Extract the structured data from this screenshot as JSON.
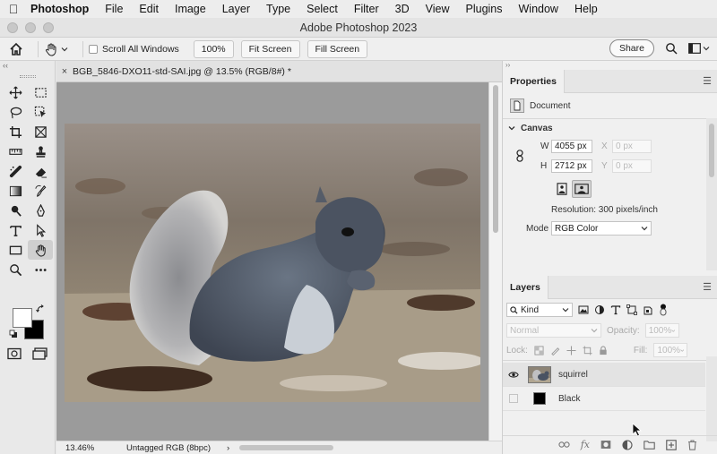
{
  "menubar": {
    "app": "Photoshop",
    "items": [
      "File",
      "Edit",
      "Image",
      "Layer",
      "Type",
      "Select",
      "Filter",
      "3D",
      "View",
      "Plugins",
      "Window",
      "Help"
    ]
  },
  "window": {
    "title": "Adobe Photoshop 2023"
  },
  "options": {
    "scroll_all_label": "Scroll All Windows",
    "zoom_100": "100%",
    "fit_screen": "Fit Screen",
    "fill_screen": "Fill Screen",
    "share": "Share"
  },
  "document": {
    "tab_title": "BGB_5846-DXO11-std-SAI.jpg @ 13.5% (RGB/8#) *",
    "close_glyph": "×"
  },
  "status": {
    "zoom": "13.46%",
    "profile": "Untagged RGB (8bpc)",
    "arrow": "›"
  },
  "properties": {
    "tab": "Properties",
    "doc_label": "Document",
    "section": "Canvas",
    "w_label": "W",
    "w_value": "4055 px",
    "h_label": "H",
    "h_value": "2712 px",
    "x_label": "X",
    "x_placeholder": "0 px",
    "y_label": "Y",
    "y_placeholder": "0 px",
    "resolution": "Resolution: 300 pixels/inch",
    "mode_label": "Mode",
    "mode_value": "RGB Color"
  },
  "layers": {
    "tab": "Layers",
    "kind": "Kind",
    "blend": "Normal",
    "opacity_label": "Opacity:",
    "opacity_value": "100%",
    "lock_label": "Lock:",
    "fill_label": "Fill:",
    "fill_value": "100%",
    "items": [
      {
        "name": "squirrel",
        "visible": true
      },
      {
        "name": "Black",
        "visible": false
      }
    ]
  }
}
